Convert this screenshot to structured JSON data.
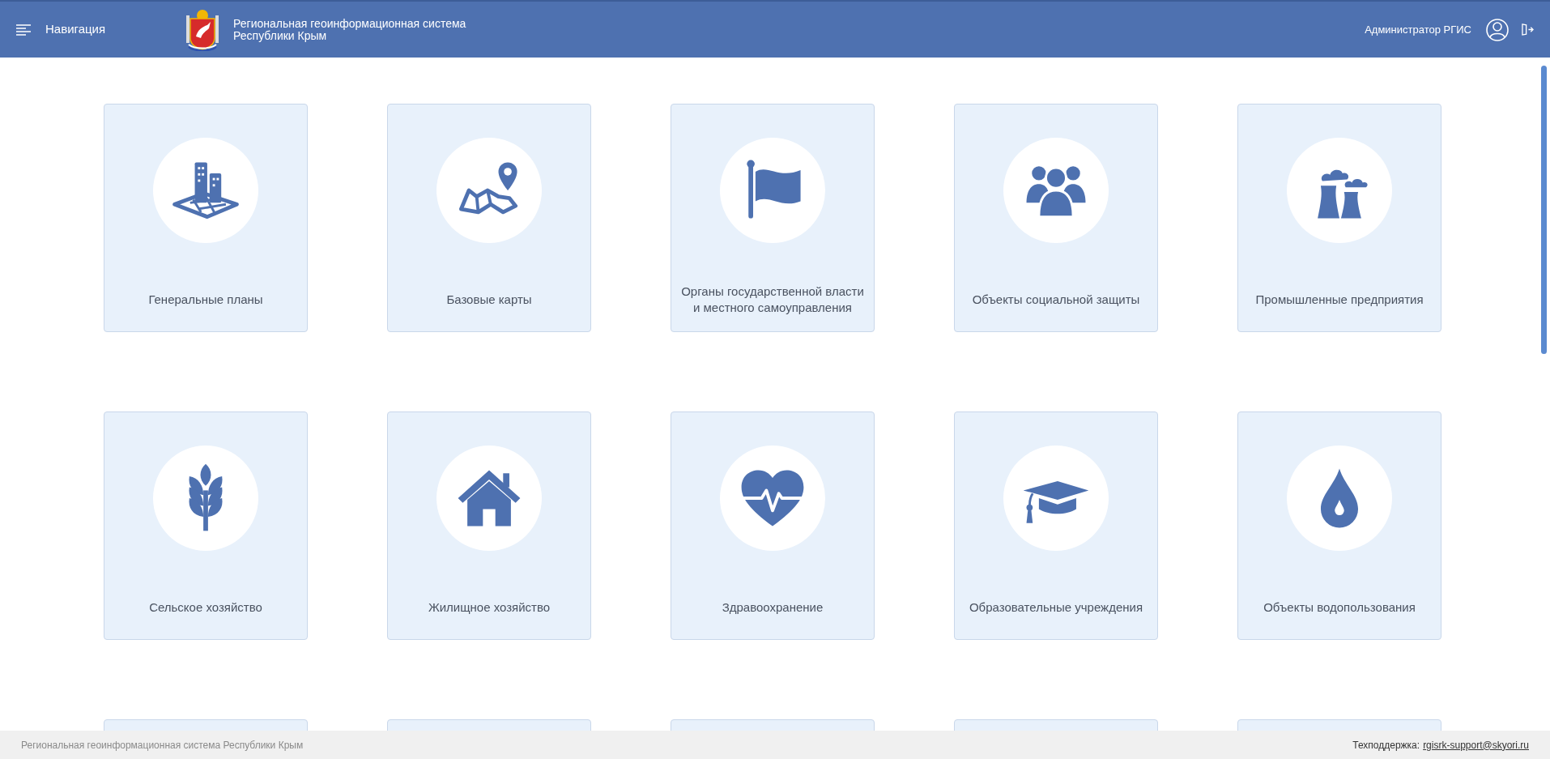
{
  "header": {
    "nav_label": "Навигация",
    "title_line1": "Региональная геоинформационная система",
    "title_line2": "Республики Крым",
    "user": "Администратор РГИС"
  },
  "tiles": [
    {
      "kind": "category",
      "label": "Генеральные планы"
    },
    {
      "kind": "category",
      "label": "Базовые карты"
    },
    {
      "kind": "category",
      "label": "Органы государственной власти и местного самоуправления"
    },
    {
      "kind": "category",
      "label": "Объекты социальной защиты"
    },
    {
      "kind": "category",
      "label": "Промышленные предприятия"
    },
    {
      "kind": "category",
      "label": "Сельское хозяйство"
    },
    {
      "kind": "category",
      "label": "Жилищное хозяйство"
    },
    {
      "kind": "category",
      "label": "Здравоохранение"
    },
    {
      "kind": "category",
      "label": "Образовательные учреждения"
    },
    {
      "kind": "category",
      "label": "Объекты водопользования"
    },
    {
      "kind": "cut-off"
    },
    {
      "kind": "cut-off"
    },
    {
      "kind": "cut-off"
    },
    {
      "kind": "cut-off"
    },
    {
      "kind": "cut-off"
    }
  ],
  "footer": {
    "system_name": "Региональная геоинформационная система Республики Крым",
    "support_label": "Техподдержка:",
    "support_email": "rgisrk-support@skyori.ru"
  }
}
